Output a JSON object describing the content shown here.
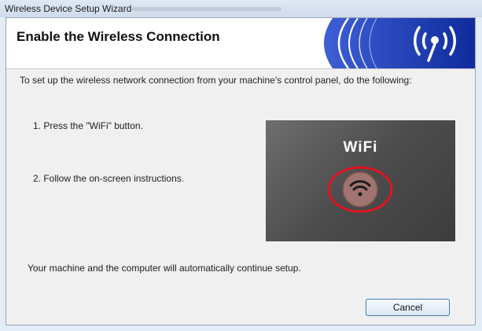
{
  "window": {
    "title": "Wireless Device Setup Wizard"
  },
  "header": {
    "title": "Enable the Wireless Connection",
    "banner_icon": "wireless-antenna-icon",
    "banner_color": "#1530a6"
  },
  "content": {
    "intro": "To set up the wireless network connection from your machine's control panel, do the following:",
    "steps": [
      "1.  Press the \"WiFi\" button.",
      "2.  Follow the on-screen instructions."
    ],
    "panel": {
      "label": "WiFi",
      "button_icon": "wifi-icon",
      "highlight_color": "#e0141e"
    },
    "footer": "Your machine and the computer will automatically continue setup."
  },
  "buttons": {
    "cancel": "Cancel"
  }
}
